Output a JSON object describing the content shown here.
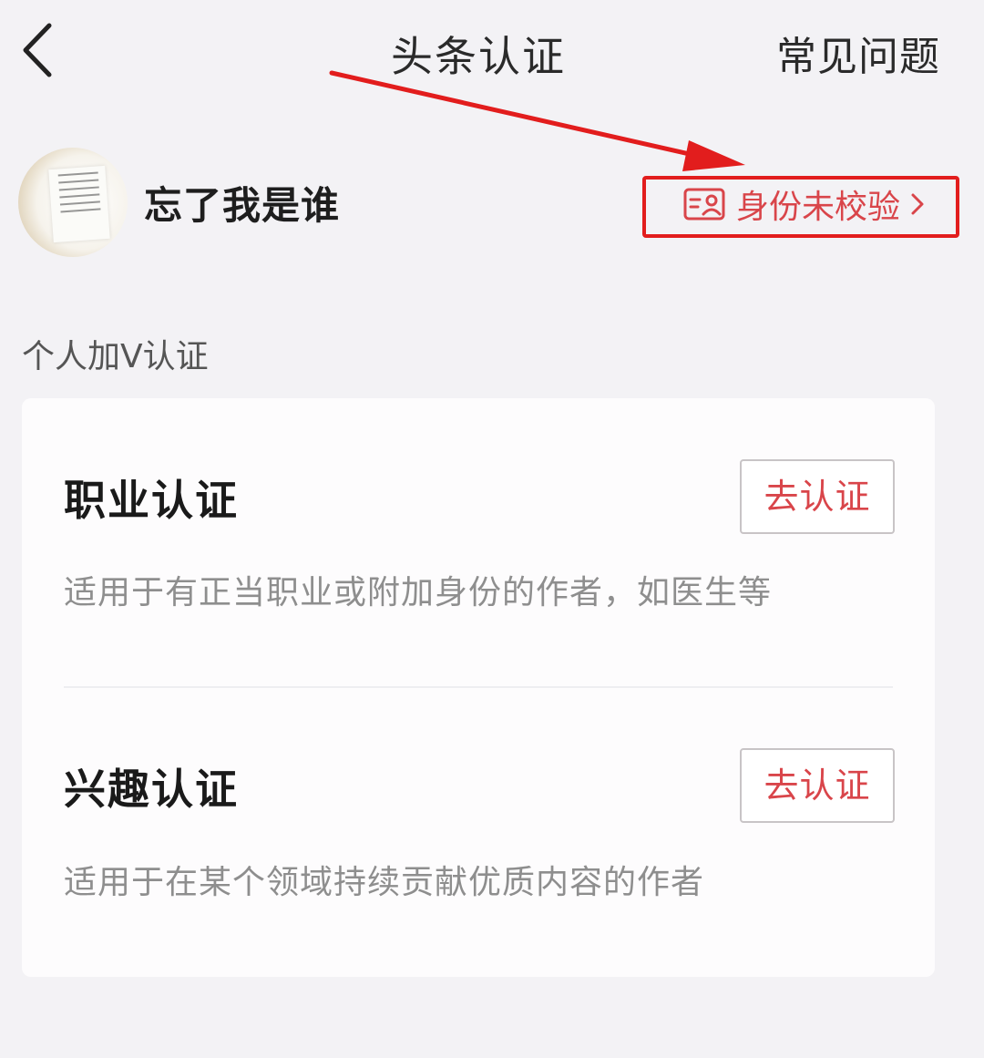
{
  "nav": {
    "title": "头条认证",
    "faq_label": "常见问题"
  },
  "profile": {
    "name": "忘了我是谁",
    "verify_status": "身份未校验"
  },
  "section": {
    "label": "个人加V认证"
  },
  "certifications": [
    {
      "title": "职业认证",
      "description": "适用于有正当职业或附加身份的作者，如医生等",
      "button_label": "去认证"
    },
    {
      "title": "兴趣认证",
      "description": "适用于在某个领域持续贡献优质内容的作者",
      "button_label": "去认证"
    }
  ],
  "colors": {
    "accent": "#d9454a",
    "annotation": "#e21d1d",
    "background": "#f3f2f5",
    "card": "#fdfcfd"
  },
  "icons": {
    "back": "chevron-left-icon",
    "verify": "id-card-icon",
    "verify_arrow": "chevron-right-icon"
  }
}
